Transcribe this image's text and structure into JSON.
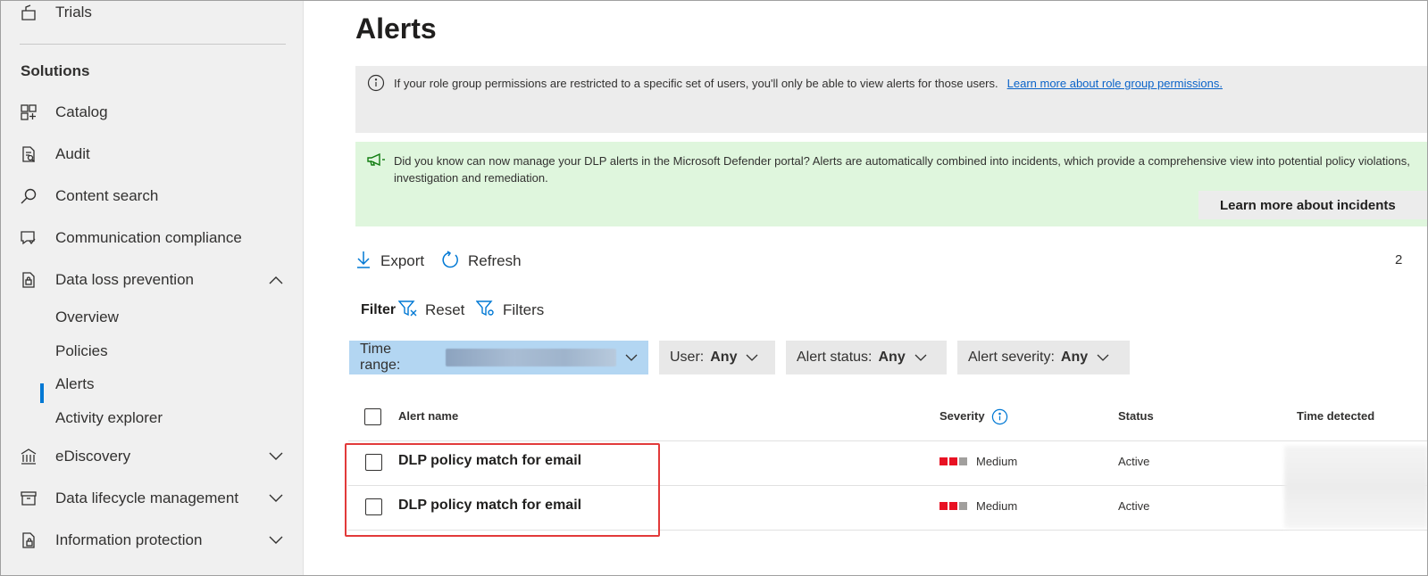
{
  "sidebar": {
    "top_item": "Trials",
    "heading": "Solutions",
    "items": [
      {
        "label": "Catalog",
        "icon": "catalog-icon"
      },
      {
        "label": "Audit",
        "icon": "audit-icon"
      },
      {
        "label": "Content search",
        "icon": "search-icon"
      },
      {
        "label": "Communication compliance",
        "icon": "communication-icon"
      },
      {
        "label": "Data loss prevention",
        "icon": "dlp-icon",
        "expanded": true
      },
      {
        "label": "eDiscovery",
        "icon": "ediscovery-icon"
      },
      {
        "label": "Data lifecycle management",
        "icon": "archive-icon"
      },
      {
        "label": "Information protection",
        "icon": "info-protection-icon"
      }
    ],
    "dlp_subitems": [
      "Overview",
      "Policies",
      "Alerts",
      "Activity explorer"
    ],
    "active_subitem": "Alerts"
  },
  "main": {
    "title": "Alerts",
    "info_banner": {
      "text": "If your role group permissions are restricted to a specific set of users, you'll only be able to view alerts for those users.",
      "link": "Learn more about role group permissions."
    },
    "promo_banner": {
      "text": "Did you know can now manage your DLP alerts in the Microsoft Defender portal? Alerts are automatically combined into incidents, which provide a comprehensive view into potential policy violations, investigation and remediation.",
      "button": "Learn more about incidents"
    },
    "commands": {
      "export": "Export",
      "refresh": "Refresh",
      "count": "2"
    },
    "filter": {
      "label": "Filter",
      "reset": "Reset",
      "filters": "Filters",
      "time_range_label": "Time range:",
      "user_label": "User:",
      "user_value": "Any",
      "status_label": "Alert status:",
      "status_value": "Any",
      "severity_label": "Alert severity:",
      "severity_value": "Any"
    },
    "table": {
      "columns": [
        "Alert name",
        "Severity",
        "Status",
        "Time detected"
      ],
      "rows": [
        {
          "name": "DLP policy match for email",
          "severity": "Medium",
          "status": "Active"
        },
        {
          "name": "DLP policy match for email",
          "severity": "Medium",
          "status": "Active"
        }
      ]
    }
  },
  "colors": {
    "accent": "#0078d4",
    "severity_filled": "#e81123",
    "severity_empty": "#a19f9d",
    "highlight": "#e23a3a",
    "promo_bg": "#dff6dd"
  }
}
